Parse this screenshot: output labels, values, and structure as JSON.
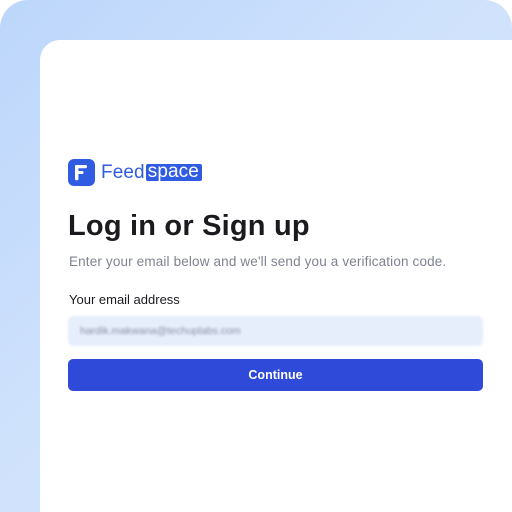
{
  "brand": {
    "name_part_1": "Feed",
    "name_part_2": "space",
    "logo_icon": "feedspace-logo-icon",
    "color": "#2f5ce0"
  },
  "auth": {
    "title": "Log in or Sign up",
    "subtitle": "Enter your email below and we'll send you a verification code.",
    "email_label": "Your email address",
    "email_value": "hardik.makwana@techuplabs.com",
    "continue_label": "Continue",
    "button_color": "#2f49d9"
  }
}
